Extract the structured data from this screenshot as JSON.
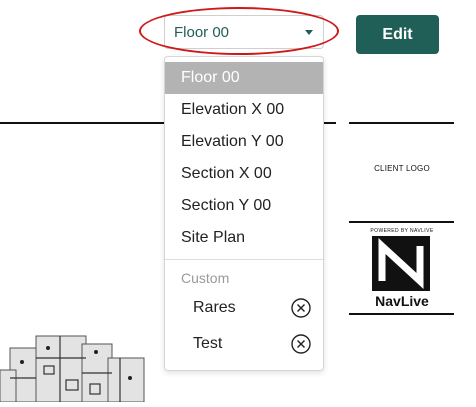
{
  "floor_select": {
    "value": "Floor 00"
  },
  "toolbar": {
    "edit_label": "Edit"
  },
  "dropdown": {
    "options": [
      "Floor 00",
      "Elevation X 00",
      "Elevation Y 00",
      "Section X 00",
      "Section Y 00",
      "Site Plan"
    ],
    "selected": "Floor 00",
    "custom_group_label": "Custom",
    "custom_items": [
      "Rares",
      "Test"
    ]
  },
  "sidebar": {
    "client_logo": "CLIENT LOGO",
    "powered_by": "POWERED BY NAVLIVE",
    "brand": "NavLive"
  },
  "colors": {
    "accent": "#1f5f58",
    "highlight": "#d01818",
    "selected_bg": "#b3b3b3"
  }
}
